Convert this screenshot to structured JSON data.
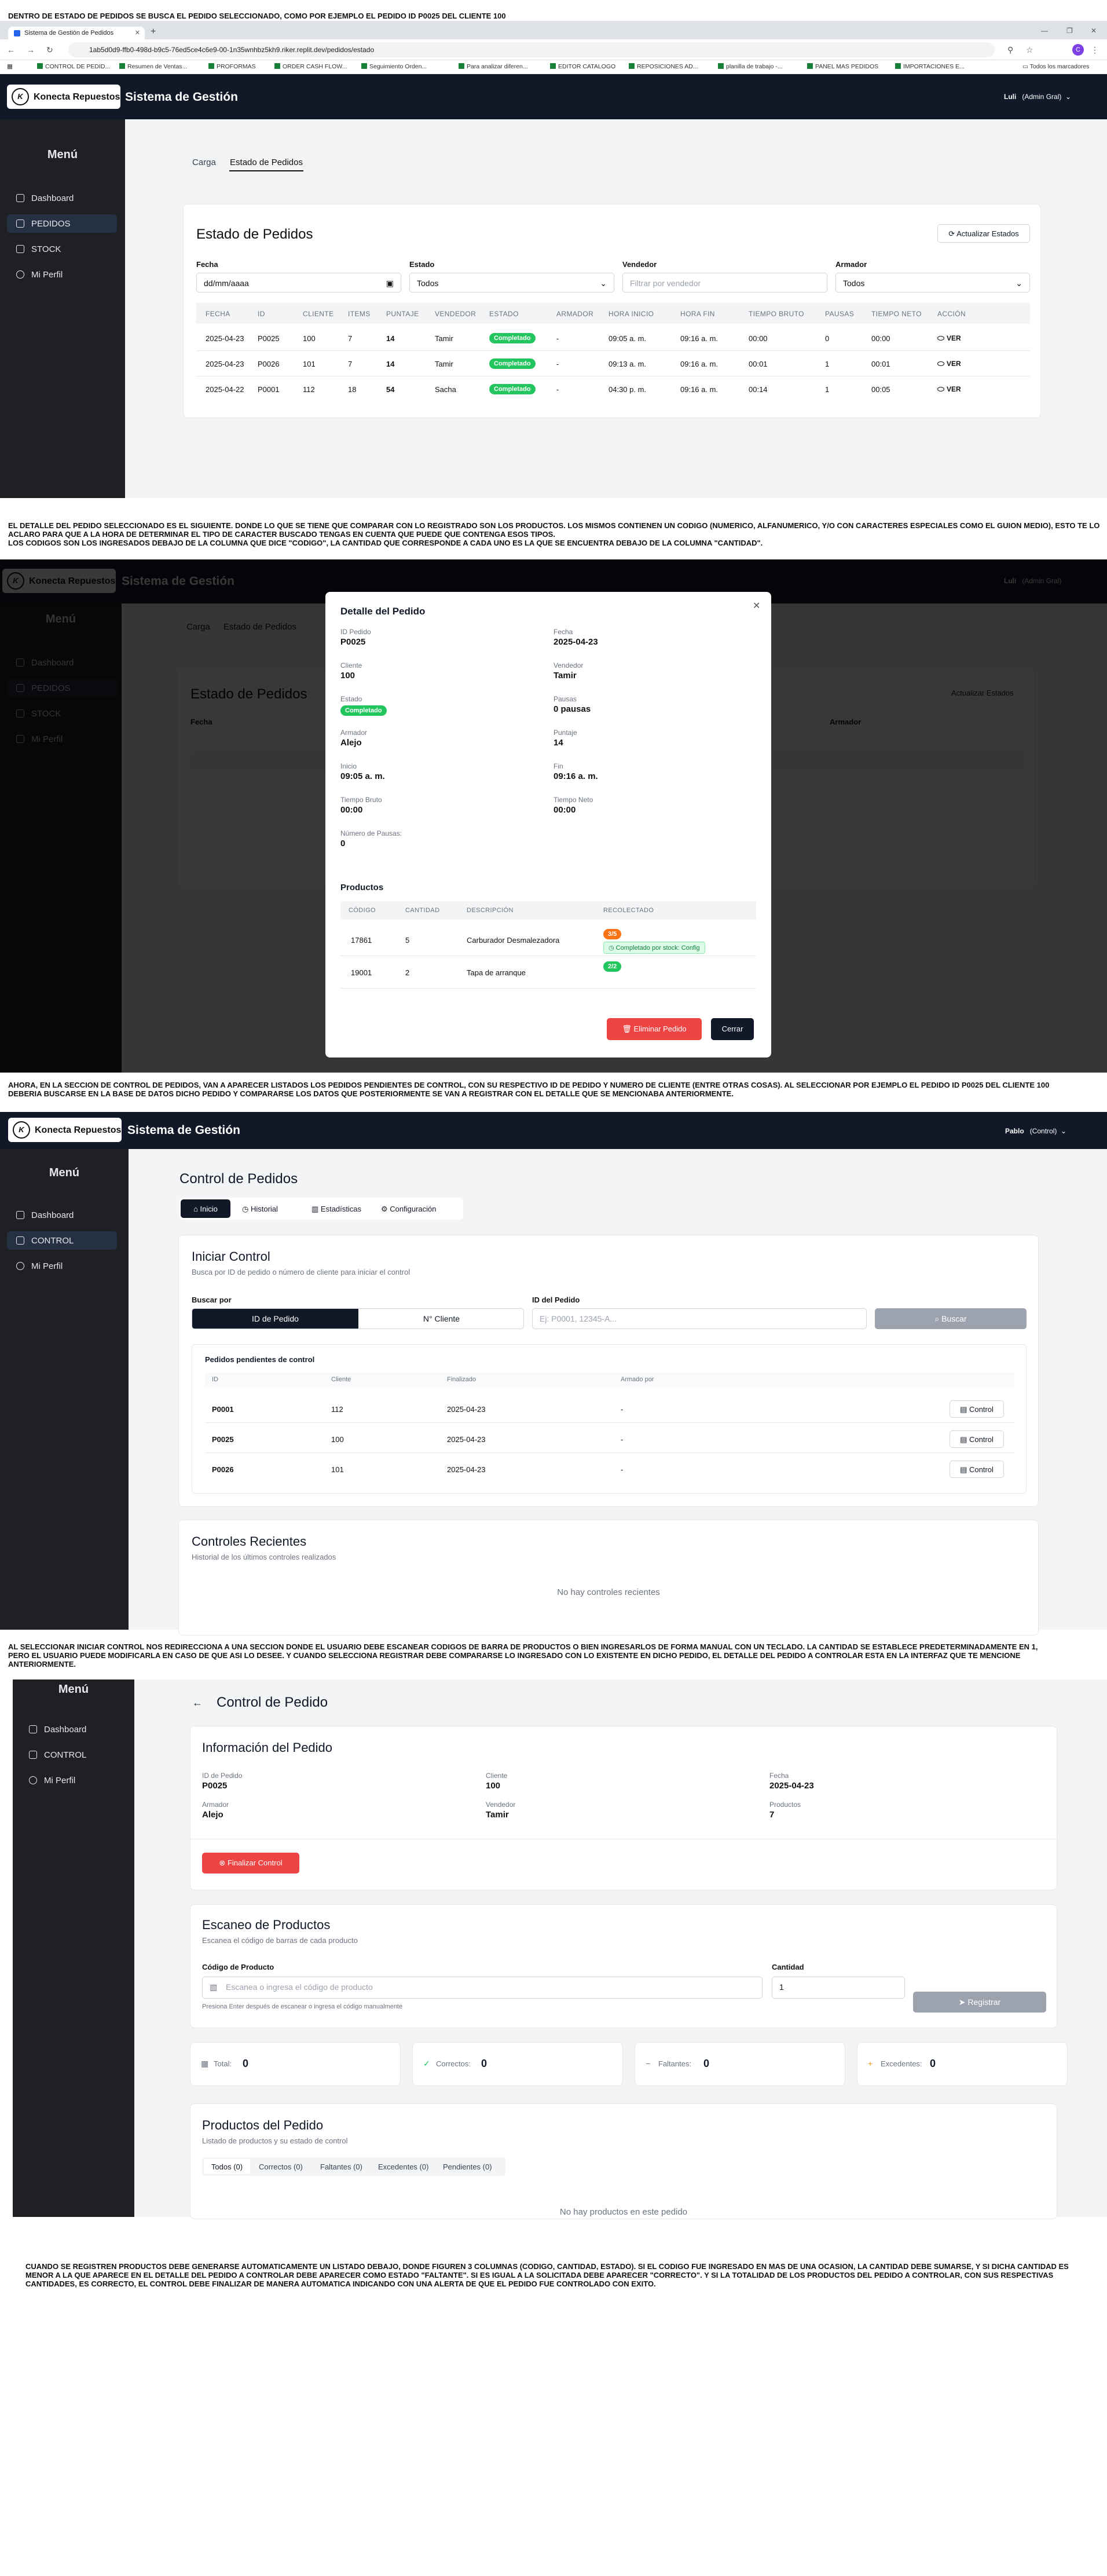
{
  "notes": {
    "n1": "DENTRO DE ESTADO DE PEDIDOS SE BUSCA EL PEDIDO SELECCIONADO, COMO POR EJEMPLO EL PEDIDO ID P0025 DEL CLIENTE 100",
    "n2": "EL DETALLE DEL PEDIDO SELECCIONADO ES EL SIGUIENTE. DONDE LO QUE SE TIENE QUE COMPARAR CON LO REGISTRADO SON LOS PRODUCTOS. LOS MISMOS CONTIENEN UN CODIGO (NUMERICO, ALFANUMERICO, Y/O CON CARACTERES ESPECIALES COMO EL GUION MEDIO), ESTO TE LO ACLARO PARA QUE A LA HORA DE DETERMINAR EL TIPO DE CARACTER BUSCADO TENGAS EN CUENTA QUE PUEDE QUE CONTENGA ESOS TIPOS.\nLOS CODIGOS SON LOS INGRESADOS DEBAJO DE LA COLUMNA QUE DICE \"CODIGO\", LA CANTIDAD QUE CORRESPONDE A CADA UNO ES LA QUE SE ENCUENTRA DEBAJO DE LA COLUMNA \"CANTIDAD\".",
    "n3": "AHORA, EN LA SECCION DE CONTROL DE PEDIDOS, VAN A APARECER LISTADOS LOS PEDIDOS PENDIENTES DE CONTROL, CON SU RESPECTIVO ID DE PEDIDO Y NUMERO DE CLIENTE (ENTRE OTRAS COSAS). AL SELECCIONAR POR EJEMPLO EL PEDIDO ID P0025 DEL CLIENTE 100\nDEBERIA BUSCARSE EN LA BASE DE DATOS DICHO PEDIDO Y COMPARARSE LOS DATOS QUE POSTERIORMENTE SE VAN A REGISTRAR CON EL DETALLE QUE SE MENCIONABA ANTERIORMENTE.",
    "n4": "AL SELECCIONAR INICIAR CONTROL NOS REDIRECCIONA A UNA SECCION DONDE EL USUARIO DEBE ESCANEAR CODIGOS DE BARRA DE PRODUCTOS O BIEN INGRESARLOS DE FORMA MANUAL CON UN TECLADO. LA CANTIDAD SE ESTABLECE PREDETERMINADAMENTE EN 1,\nPERO EL USUARIO PUEDE MODIFICARLA EN CASO DE QUE ASI LO DESEE. Y CUANDO SELECCIONA REGISTRAR DEBE COMPARARSE LO INGRESADO CON LO EXISTENTE EN DICHO PEDIDO, EL DETALLE DEL PEDIDO A CONTROLAR ESTA EN LA INTERFAZ QUE TE MENCIONE\nANTERIORMENTE.",
    "n5": "CUANDO SE REGISTREN PRODUCTOS DEBE GENERARSE AUTOMATICAMENTE UN LISTADO DEBAJO, DONDE FIGUREN 3 COLUMNAS (CODIGO, CANTIDAD, ESTADO). SI EL CODIGO FUE INGRESADO EN MAS DE UNA OCASION, LA CANTIDAD DEBE SUMARSE, Y SI DICHA CANTIDAD ES\nMENOR A LA QUE APARECE EN EL DETALLE DEL PEDIDO A CONTROLAR DEBE APARECER COMO ESTADO \"FALTANTE\". SI ES IGUAL A LA SOLICITADA DEBE APARECER \"CORRECTO\". Y SI LA TOTALIDAD DE LOS PRODUCTOS DEL PEDIDO A CONTROLAR, CON SUS RESPECTIVAS\nCANTIDADES, ES CORRECTO, EL CONTROL DEBE FINALIZAR DE MANERA AUTOMATICA INDICANDO CON UNA ALERTA DE QUE EL PEDIDO FUE CONTROLADO CON EXITO."
  },
  "browser": {
    "tab_title": "Sistema de Gestión de Pedidos",
    "url": "1ab5d0d9-ffb0-498d-b9c5-76ed5ce4c6e9-00-1n35wnhbz5kh9.riker.replit.dev/pedidos/estado",
    "bookmarks": [
      "CONTROL DE PEDID...",
      "Resumen de Ventas...",
      "PROFORMAS",
      "ORDER CASH FLOW...",
      "Seguimiento Orden...",
      "Para analizar diferen...",
      "EDITOR CATALOGO",
      "REPOSICIONES AD...",
      "planilla de trabajo -...",
      "PANEL MAS PEDIDOS",
      "IMPORTACIONES E...",
      "Todos los marcadores"
    ]
  },
  "app": {
    "logo": "Konecta Repuestos",
    "title": "Sistema de Gestión",
    "logo_mark": "K"
  },
  "s1": {
    "user": "Luli",
    "role": "(Admin Gral)",
    "menu_title": "Menú",
    "menu": [
      "Dashboard",
      "PEDIDOS",
      "STOCK",
      "Mi Perfil"
    ],
    "tabs": [
      "Carga",
      "Estado de Pedidos"
    ],
    "card_title": "Estado de Pedidos",
    "refresh_btn": "Actualizar Estados",
    "filters": {
      "fecha_label": "Fecha",
      "fecha_value": "dd/mm/aaaa",
      "estado_label": "Estado",
      "estado_value": "Todos",
      "vendedor_label": "Vendedor",
      "vendedor_ph": "Filtrar por vendedor",
      "armador_label": "Armador",
      "armador_value": "Todos"
    },
    "columns": [
      "FECHA",
      "ID",
      "CLIENTE",
      "ITEMS",
      "PUNTAJE",
      "VENDEDOR",
      "ESTADO",
      "ARMADOR",
      "HORA INICIO",
      "HORA FIN",
      "TIEMPO BRUTO",
      "PAUSAS",
      "TIEMPO NETO",
      "ACCIÓN"
    ],
    "rows": [
      [
        "2025-04-23",
        "P0025",
        "100",
        "7",
        "14",
        "Tamir",
        "Completado",
        "-",
        "09:05 a. m.",
        "09:16 a. m.",
        "00:00",
        "0",
        "00:00",
        "VER"
      ],
      [
        "2025-04-23",
        "P0026",
        "101",
        "7",
        "14",
        "Tamir",
        "Completado",
        "-",
        "09:13 a. m.",
        "09:16 a. m.",
        "00:01",
        "1",
        "00:01",
        "VER"
      ],
      [
        "2025-04-22",
        "P0001",
        "112",
        "18",
        "54",
        "Sacha",
        "Completado",
        "-",
        "04:30 p. m.",
        "09:16 a. m.",
        "00:14",
        "1",
        "00:05",
        "VER"
      ]
    ]
  },
  "s2": {
    "modal_title": "Detalle del Pedido",
    "fields": [
      {
        "label": "ID Pedido",
        "value": "P0025"
      },
      {
        "label": "Fecha",
        "value": "2025-04-23"
      },
      {
        "label": "Cliente",
        "value": "100"
      },
      {
        "label": "Vendedor",
        "value": "Tamir"
      },
      {
        "label": "Estado",
        "value": "Completado"
      },
      {
        "label": "Pausas",
        "value": "0 pausas"
      },
      {
        "label": "Armador",
        "value": "Alejo"
      },
      {
        "label": "Puntaje",
        "value": "14"
      },
      {
        "label": "Inicio",
        "value": "09:05 a. m."
      },
      {
        "label": "Fin",
        "value": "09:16 a. m."
      },
      {
        "label": "Tiempo Bruto",
        "value": "00:00"
      },
      {
        "label": "Tiempo Neto",
        "value": "00:00"
      },
      {
        "label": "Número de Pausas:",
        "value": "0"
      }
    ],
    "products_title": "Productos",
    "product_columns": [
      "CÓDIGO",
      "CANTIDAD",
      "DESCRIPCIÓN",
      "RECOLECTADO"
    ],
    "products": [
      {
        "code": "17861",
        "qty": "5",
        "desc": "Carburador Desmalezadora",
        "collected": "3/5",
        "note": "Completado por stock: Config"
      },
      {
        "code": "19001",
        "qty": "2",
        "desc": "Tapa de arranque",
        "collected": "2/2",
        "note": ""
      }
    ],
    "delete_btn": "Eliminar Pedido",
    "close_btn": "Cerrar"
  },
  "s3": {
    "user": "Pablo",
    "role": "(Control)",
    "menu_title": "Menú",
    "menu": [
      "Dashboard",
      "CONTROL",
      "Mi Perfil"
    ],
    "page_title": "Control de Pedidos",
    "tabs": [
      "Inicio",
      "Historial",
      "Estadísticas",
      "Configuración"
    ],
    "start_title": "Iniciar Control",
    "start_sub": "Busca por ID de pedido o número de cliente para iniciar el control",
    "search_by": "Buscar por",
    "toggle": [
      "ID de Pedido",
      "N° Cliente"
    ],
    "id_label": "ID del Pedido",
    "id_ph": "Ej: P0001, 12345-A...",
    "search_btn": "Buscar",
    "pending_title": "Pedidos pendientes de control",
    "pending_cols": [
      "ID",
      "Cliente",
      "Finalizado",
      "Armado por"
    ],
    "pending": [
      [
        "P0001",
        "112",
        "2025-04-23",
        "-"
      ],
      [
        "P0025",
        "100",
        "2025-04-23",
        "-"
      ],
      [
        "P0026",
        "101",
        "2025-04-23",
        "-"
      ]
    ],
    "control_btn": "Control",
    "recent_title": "Controles Recientes",
    "recent_sub": "Historial de los últimos controles realizados",
    "recent_empty": "No hay controles recientes"
  },
  "s4": {
    "menu_title": "Menú",
    "menu": [
      "Dashboard",
      "CONTROL",
      "Mi Perfil"
    ],
    "page_title": "Control de Pedido",
    "info_title": "Información del Pedido",
    "info": [
      {
        "label": "ID de Pedido",
        "value": "P0025"
      },
      {
        "label": "Cliente",
        "value": "100"
      },
      {
        "label": "Fecha",
        "value": "2025-04-23"
      },
      {
        "label": "Armador",
        "value": "Alejo"
      },
      {
        "label": "Vendedor",
        "value": "Tamir"
      },
      {
        "label": "Productos",
        "value": "7"
      }
    ],
    "finish_btn": "Finalizar Control",
    "scan_title": "Escaneo de Productos",
    "scan_sub": "Escanea el código de barras de cada producto",
    "code_label": "Código de Producto",
    "code_ph": "Escanea o ingresa el código de producto",
    "code_hint": "Presiona Enter después de escanear o ingresa el código manualmente",
    "qty_label": "Cantidad",
    "qty_value": "1",
    "register_btn": "Registrar",
    "stats": [
      {
        "label": "Total:",
        "value": "0"
      },
      {
        "label": "Correctos:",
        "value": "0"
      },
      {
        "label": "Faltantes:",
        "value": "0"
      },
      {
        "label": "Excedentes:",
        "value": "0"
      }
    ],
    "products_title": "Productos del Pedido",
    "products_sub": "Listado de productos y su estado de control",
    "filter_tabs": [
      "Todos (0)",
      "Correctos (0)",
      "Faltantes (0)",
      "Excedentes (0)",
      "Pendientes (0)"
    ],
    "empty": "No hay productos en este pedido"
  },
  "colors": {
    "sidebar": "#1f2023",
    "topbar": "#111827",
    "success": "#22c55e",
    "danger": "#ef4444",
    "primary": "#111827"
  }
}
